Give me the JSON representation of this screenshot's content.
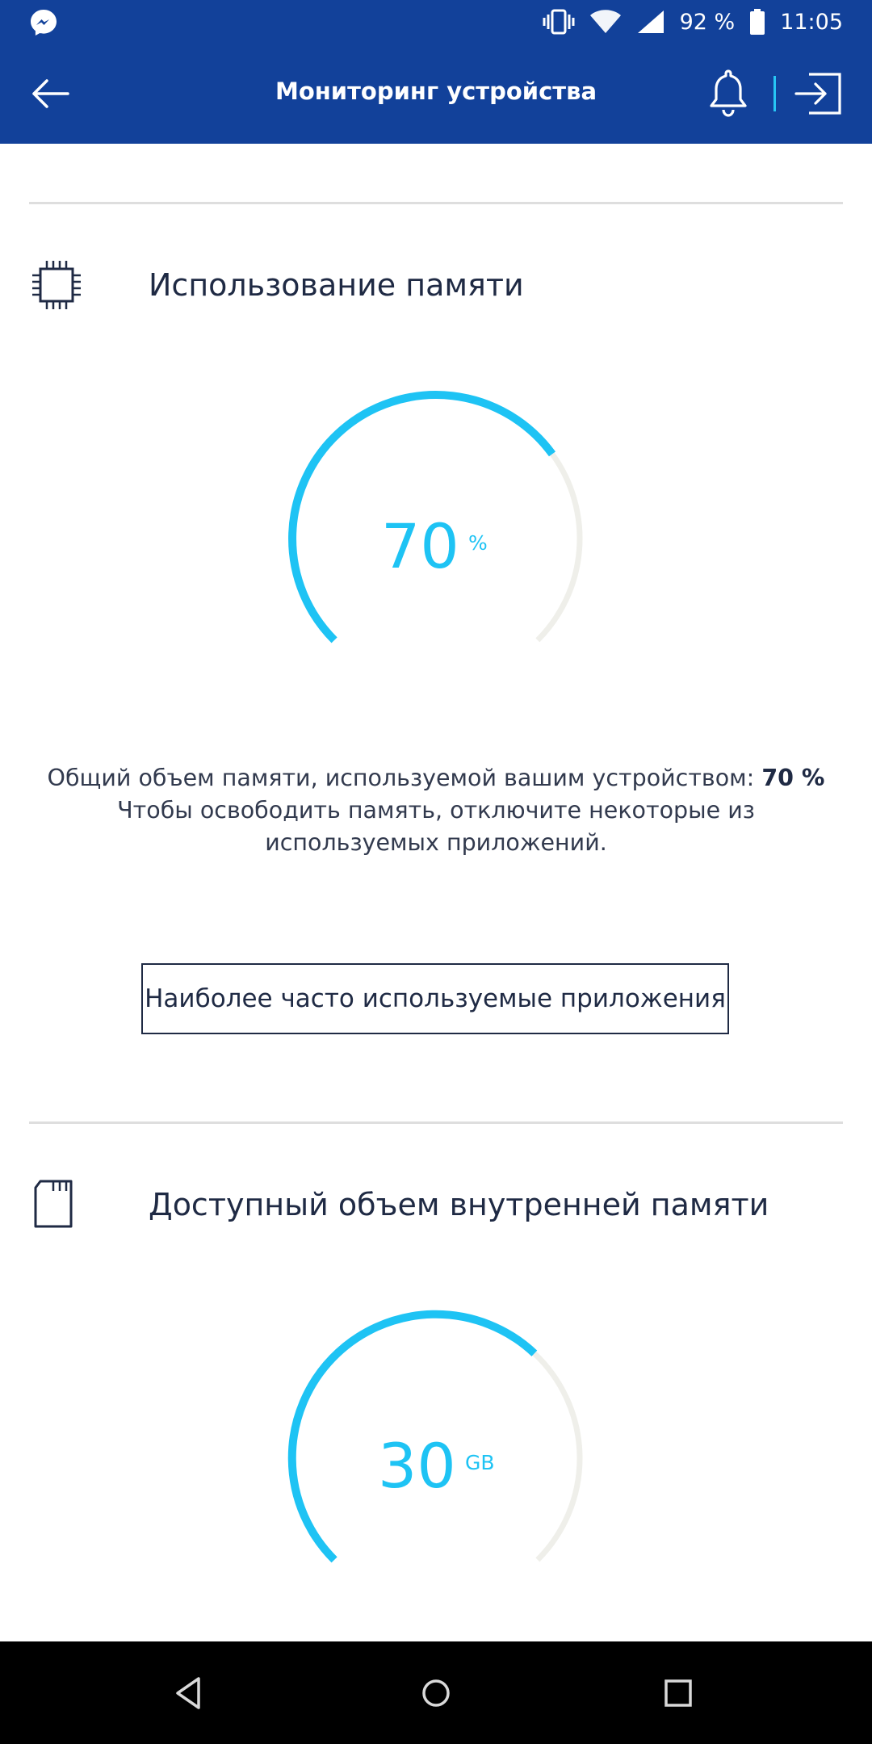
{
  "status_bar": {
    "battery_level": "92 %",
    "time": "11:05",
    "icons": [
      "messenger-icon",
      "vibrate-icon",
      "wifi-icon",
      "signal-icon",
      "battery-icon"
    ]
  },
  "app_bar": {
    "title": "Мониторинг устройства",
    "icons": [
      "back-arrow-icon",
      "bell-icon",
      "exit-icon"
    ],
    "accent_color": "#12419a",
    "separator_color": "#27c6f5"
  },
  "memory": {
    "title": "Использование памяти",
    "icon": "chip-icon",
    "gauge": {
      "value": "70",
      "unit": "%",
      "fraction": 0.7,
      "color": "#1ec3f4",
      "track_color": "#efefea"
    },
    "description_prefix": "Общий объем памяти, используемой вашим устройством: ",
    "description_value": "70 %",
    "description_suffix": " Чтобы освободить память, отключите некоторые из используемых приложений.",
    "button_label": "Наиболее часто используемые приложения"
  },
  "storage": {
    "title": "Доступный объем внутренней памяти",
    "icon": "sd-card-icon",
    "gauge": {
      "value": "30",
      "unit": "GB",
      "fraction": 0.66,
      "color": "#1ec3f4",
      "track_color": "#efefea"
    }
  },
  "nav_bar": {
    "icons": [
      "nav-back-icon",
      "nav-home-icon",
      "nav-recents-icon"
    ]
  }
}
